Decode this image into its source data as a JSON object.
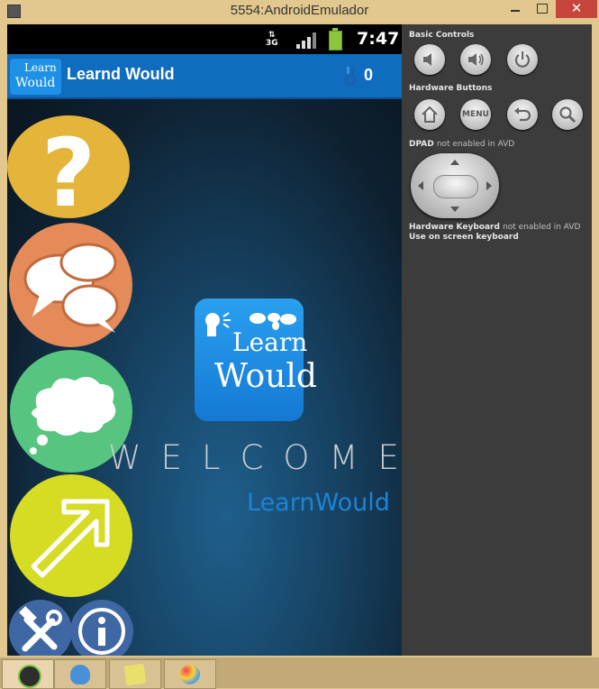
{
  "window": {
    "title": "5554:AndroidEmulador",
    "close_glyph": "✕"
  },
  "status_bar": {
    "network": "3G",
    "time": "7:47"
  },
  "action_bar": {
    "logo_line1": "Learn",
    "logo_line2": "Would",
    "title": "Learnd Would",
    "medal_count": "0"
  },
  "main": {
    "menu_buttons": [
      "question-mark-icon",
      "speech-bubbles-icon",
      "thought-bubble-icon",
      "arrow-up-right-icon",
      "tools-icon",
      "info-icon"
    ],
    "logo_line1": "Learn",
    "logo_line2": "Would",
    "welcome": "WELCOME",
    "subtitle": "LearnWould"
  },
  "panel": {
    "basic_controls": "Basic Controls",
    "hardware_buttons": "Hardware Buttons",
    "menu_label": "MENU",
    "dpad": "DPAD",
    "dpad_note": "not enabled in AVD",
    "keyboard": "Hardware Keyboard",
    "keyboard_note": "not enabled in AVD",
    "screen_keyboard": "Use on screen keyboard"
  },
  "taskbar": {
    "items": [
      "android-terminal-icon",
      "emulator-app-icon",
      "sticky-notes-icon",
      "paint-icon"
    ]
  },
  "colors": {
    "accent": "#0f6cbf",
    "quiz": "#e5b43a",
    "chat": "#e58a59",
    "speak": "#57c47f",
    "next": "#d6db23",
    "tools": "#3f67a3"
  }
}
